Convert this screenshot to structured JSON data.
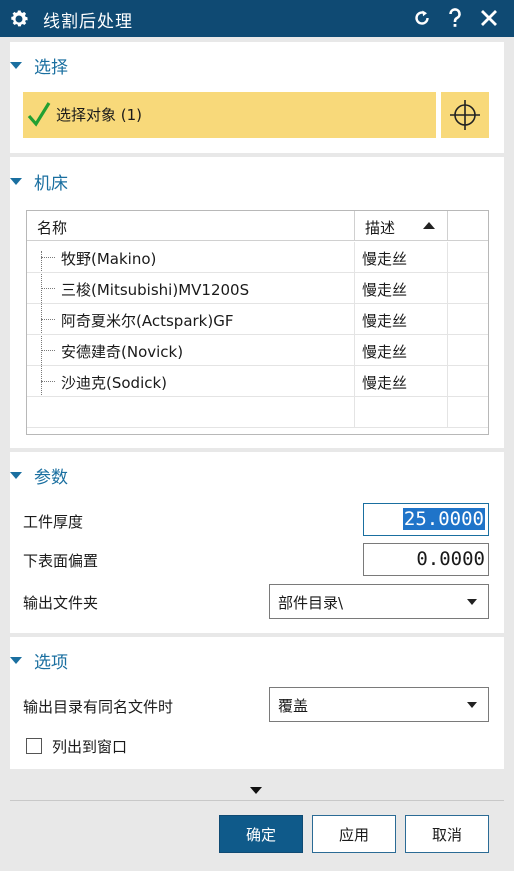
{
  "window": {
    "title": "线割后处理",
    "icons": {
      "settings": "gear-icon",
      "reset": "reset-icon",
      "help": "help-icon",
      "close": "close-icon"
    }
  },
  "selection": {
    "section_title": "选择",
    "row_label": "选择对象 (1)",
    "check_icon": "check-icon",
    "target_icon": "crosshair-icon",
    "highlight_color": "#f8d97a"
  },
  "machine": {
    "section_title": "机床",
    "columns": [
      "名称",
      "描述"
    ],
    "sort": "ascending",
    "rows": [
      {
        "name": "牧野(Makino)",
        "desc": "慢走丝"
      },
      {
        "name": "三梭(Mitsubishi)MV1200S",
        "desc": "慢走丝"
      },
      {
        "name": "阿奇夏米尔(Actspark)GF",
        "desc": "慢走丝"
      },
      {
        "name": "安德建奇(Novick)",
        "desc": "慢走丝"
      },
      {
        "name": "沙迪克(Sodick)",
        "desc": "慢走丝"
      }
    ]
  },
  "params": {
    "section_title": "参数",
    "thickness_label": "工件厚度",
    "thickness_value": "25.0000",
    "offset_label": "下表面偏置",
    "offset_value": "0.0000",
    "folder_label": "输出文件夹",
    "folder_value": "部件目录\\"
  },
  "options": {
    "section_title": "选项",
    "samename_label": "输出目录有同名文件时",
    "samename_value": "覆盖",
    "list_label": "列出到窗口",
    "list_checked": false
  },
  "footer": {
    "ok": "确定",
    "apply": "应用",
    "cancel": "取消",
    "accent": "#0f5a8a"
  }
}
